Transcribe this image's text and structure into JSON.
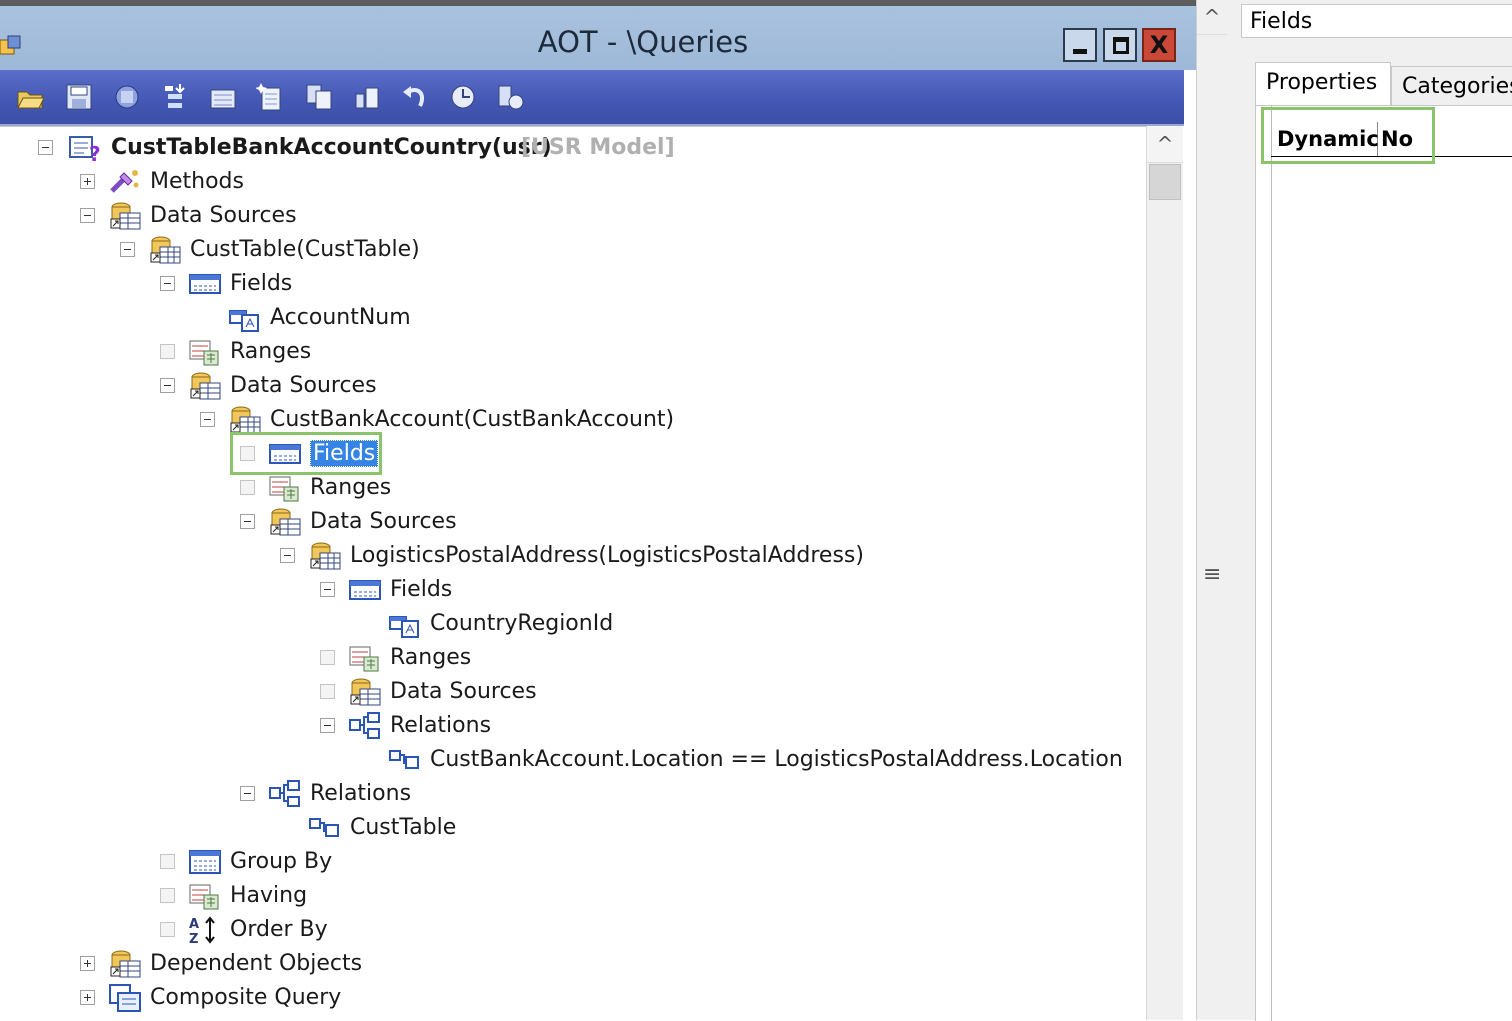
{
  "window": {
    "title": "AOT - \\Queries",
    "close_glyph": "X"
  },
  "toolbar": {
    "icons": [
      "open-icon",
      "save-icon",
      "compile-icon",
      "import-icon",
      "properties-icon",
      "new-icon",
      "duplicate-icon",
      "layers-icon",
      "undo-icon",
      "find-icon",
      "restore-icon"
    ]
  },
  "tree": {
    "root_label": "CustTableBankAccountCountry(usr)",
    "root_model": "[USR Model]",
    "nodes": [
      {
        "label": "Methods"
      },
      {
        "label": "Data Sources"
      },
      {
        "label": "CustTable(CustTable)"
      },
      {
        "label": "Fields"
      },
      {
        "label": "AccountNum"
      },
      {
        "label": "Ranges"
      },
      {
        "label": "Data Sources"
      },
      {
        "label": "CustBankAccount(CustBankAccount)"
      },
      {
        "label": "Fields"
      },
      {
        "label": "Ranges"
      },
      {
        "label": "Data Sources"
      },
      {
        "label": "LogisticsPostalAddress(LogisticsPostalAddress)"
      },
      {
        "label": "Fields"
      },
      {
        "label": "CountryRegionId"
      },
      {
        "label": "Ranges"
      },
      {
        "label": "Data Sources"
      },
      {
        "label": "Relations"
      },
      {
        "label": "CustBankAccount.Location == LogisticsPostalAddress.Location"
      },
      {
        "label": "Relations"
      },
      {
        "label": "CustTable"
      },
      {
        "label": "Group By"
      },
      {
        "label": "Having"
      },
      {
        "label": "Order By"
      },
      {
        "label": "Dependent Objects"
      },
      {
        "label": "Composite Query"
      }
    ]
  },
  "properties": {
    "header": "Fields",
    "tabs": [
      "Properties",
      "Categories"
    ],
    "row": {
      "name": "Dynamic",
      "value": "No"
    }
  },
  "scroll": {
    "up_glyph": "^",
    "grip_glyph": "≡"
  },
  "colors": {
    "selection": "#3584e4",
    "highlight_box": "#8cc46b",
    "toolbar": "#4458b5"
  }
}
